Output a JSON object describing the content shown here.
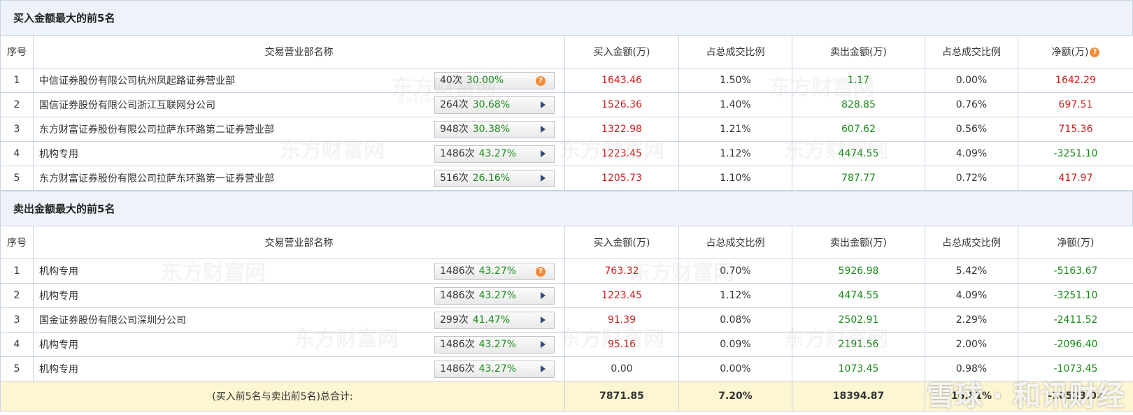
{
  "headers": [
    "序号",
    "交易营业部名称",
    "买入金额(万)",
    "占总成交比例",
    "卖出金额(万)",
    "占总成交比例",
    "净额(万)"
  ],
  "buy_section": {
    "title": "买入金额最大的前5名",
    "rows": [
      {
        "idx": "1",
        "name": "中信证券股份有限公司杭州凤起路证券营业部",
        "count": "40次",
        "rate": "30.00%",
        "btn": "qmark",
        "buy": "1643.46",
        "buy_pct": "1.50%",
        "sell": "1.17",
        "sell_pct": "0.00%",
        "net": "1642.29"
      },
      {
        "idx": "2",
        "name": "国信证券股份有限公司浙江互联网分公司",
        "count": "264次",
        "rate": "30.68%",
        "btn": "arrow",
        "buy": "1526.36",
        "buy_pct": "1.40%",
        "sell": "828.85",
        "sell_pct": "0.76%",
        "net": "697.51"
      },
      {
        "idx": "3",
        "name": "东方财富证券股份有限公司拉萨东环路第二证券营业部",
        "count": "948次",
        "rate": "30.38%",
        "btn": "arrow",
        "buy": "1322.98",
        "buy_pct": "1.21%",
        "sell": "607.62",
        "sell_pct": "0.56%",
        "net": "715.36"
      },
      {
        "idx": "4",
        "name": "机构专用",
        "count": "1486次",
        "rate": "43.27%",
        "btn": "arrow",
        "buy": "1223.45",
        "buy_pct": "1.12%",
        "sell": "4474.55",
        "sell_pct": "4.09%",
        "net": "-3251.10"
      },
      {
        "idx": "5",
        "name": "东方财富证券股份有限公司拉萨东环路第一证券营业部",
        "count": "516次",
        "rate": "26.16%",
        "btn": "arrow",
        "buy": "1205.73",
        "buy_pct": "1.10%",
        "sell": "787.77",
        "sell_pct": "0.72%",
        "net": "417.97"
      }
    ]
  },
  "sell_section": {
    "title": "卖出金额最大的前5名",
    "rows": [
      {
        "idx": "1",
        "name": "机构专用",
        "count": "1486次",
        "rate": "43.27%",
        "btn": "qmark",
        "buy": "763.32",
        "buy_pct": "0.70%",
        "sell": "5926.98",
        "sell_pct": "5.42%",
        "net": "-5163.67"
      },
      {
        "idx": "2",
        "name": "机构专用",
        "count": "1486次",
        "rate": "43.27%",
        "btn": "arrow",
        "buy": "1223.45",
        "buy_pct": "1.12%",
        "sell": "4474.55",
        "sell_pct": "4.09%",
        "net": "-3251.10"
      },
      {
        "idx": "3",
        "name": "国金证券股份有限公司深圳分公司",
        "count": "299次",
        "rate": "41.47%",
        "btn": "arrow",
        "buy": "91.39",
        "buy_pct": "0.08%",
        "sell": "2502.91",
        "sell_pct": "2.29%",
        "net": "-2411.52"
      },
      {
        "idx": "4",
        "name": "机构专用",
        "count": "1486次",
        "rate": "43.27%",
        "btn": "arrow",
        "buy": "95.16",
        "buy_pct": "0.09%",
        "sell": "2191.56",
        "sell_pct": "2.00%",
        "net": "-2096.40"
      },
      {
        "idx": "5",
        "name": "机构专用",
        "count": "1486次",
        "rate": "43.27%",
        "btn": "arrow",
        "buy": "0.00",
        "buy_pct": "0.00%",
        "sell": "1073.45",
        "sell_pct": "0.98%",
        "net": "-1073.45"
      }
    ],
    "total": {
      "label": "(买入前5名与卖出前5名)总合计:",
      "buy": "7871.85",
      "buy_pct": "7.20%",
      "sell": "18394.87",
      "sell_pct": "16.81%",
      "net": "-10523.02"
    }
  },
  "watermark": {
    "brand": "东方财富网",
    "domain": "eastmoney.com",
    "corner": "雪球 · 和讯财经"
  },
  "colors": {
    "red": "#cc1f1f",
    "green": "#1a8b1a",
    "header_bg": "#eef3fb",
    "total_bg": "#fdf6d3"
  }
}
